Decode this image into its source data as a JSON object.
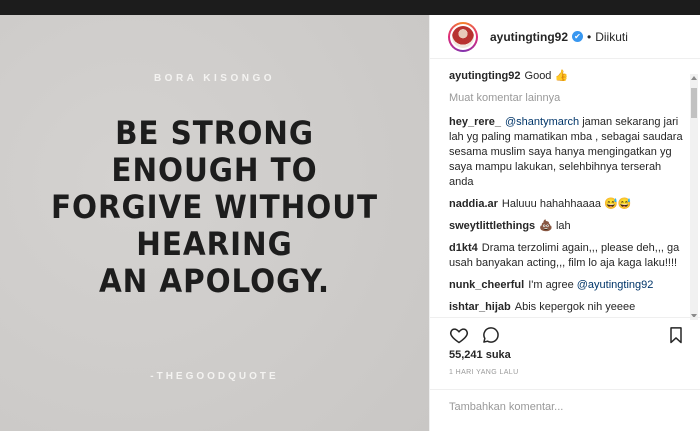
{
  "post": {
    "author_credit": "BORA KISONGO",
    "quote_lines": [
      "BE STRONG",
      "ENOUGH TO",
      "FORGIVE WITHOUT",
      "HEARING",
      "AN APOLOGY."
    ],
    "source": "-THEGOODQUOTE"
  },
  "header": {
    "username": "ayutingting92",
    "verified": "✔",
    "separator": "•",
    "follow_status": "Diikuti"
  },
  "caption": {
    "username": "ayutingting92",
    "text": "Good 👍"
  },
  "load_more": "Muat komentar lainnya",
  "comments": [
    {
      "user": "hey_rere_",
      "mention": "@shantymarch",
      "text": " jaman sekarang jari lah yg paling mamatikan mba , sebagai saudara sesama muslim saya hanya mengingatkan yg saya mampu lakukan, selehbihnya terserah anda"
    },
    {
      "user": "naddia.ar",
      "mention": "",
      "text": "Haluuu hahahhaaaa 😅😅"
    },
    {
      "user": "sweytlittlethings",
      "mention": "",
      "text": "💩 lah"
    },
    {
      "user": "d1kt4",
      "mention": "",
      "text": "Drama terzolimi again,,, please deh,,, ga usah banyakan acting,,, film lo aja kaga laku!!!!"
    },
    {
      "user": "nunk_cheerful",
      "mention": "@ayutingting92",
      "text": "I'm agree "
    },
    {
      "user": "ishtar_hijab",
      "mention": "",
      "text": "Abis kepergok nih yeeee"
    }
  ],
  "likes": "55,241 suka",
  "timestamp": "1 HARI YANG LALU",
  "add_comment_placeholder": "Tambahkan komentar...",
  "icons": {
    "like": "heart-icon",
    "comment": "comment-icon",
    "save": "bookmark-icon"
  },
  "colors": {
    "verified": "#3897f0",
    "mention": "#003569",
    "quote_text": "#1d1d1d",
    "photo_bg": "#cfcdcb"
  }
}
